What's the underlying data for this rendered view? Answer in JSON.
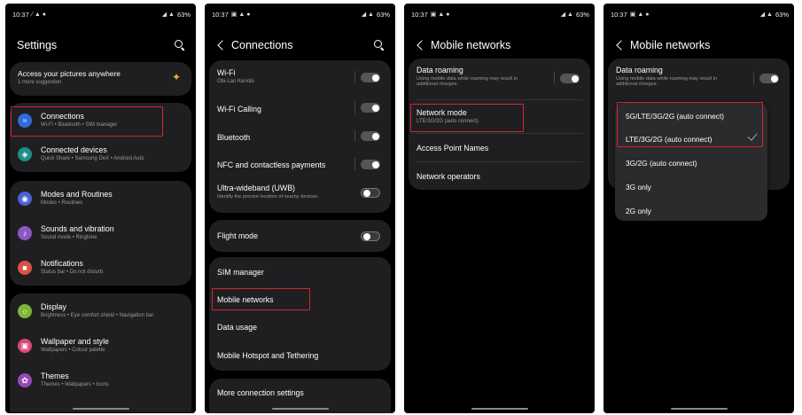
{
  "status": {
    "time": "10:37",
    "battery": "63%"
  },
  "settings": {
    "title": "Settings",
    "suggestion": {
      "title": "Access your pictures anywhere",
      "sub": "1 more suggestion"
    },
    "items": [
      {
        "label": "Connections",
        "sub": "Wi-Fi  •  Bluetooth  •  SIM manager",
        "color": "#2d6cdf",
        "icon": "wifi-icon"
      },
      {
        "label": "Connected devices",
        "sub": "Quick Share  •  Samsung DeX  •  Android Auto",
        "color": "#1f8f86",
        "icon": "devices-icon"
      },
      {
        "label": "Modes and Routines",
        "sub": "Modes  •  Routines",
        "color": "#4a63d6",
        "icon": "routine-icon"
      },
      {
        "label": "Sounds and vibration",
        "sub": "Sound mode  •  Ringtone",
        "color": "#8b58c8",
        "icon": "sound-icon"
      },
      {
        "label": "Notifications",
        "sub": "Status bar  •  Do not disturb",
        "color": "#d95245",
        "icon": "notification-icon"
      },
      {
        "label": "Display",
        "sub": "Brightness  •  Eye comfort shield  •  Navigation bar",
        "color": "#7fb436",
        "icon": "display-icon"
      },
      {
        "label": "Wallpaper and style",
        "sub": "Wallpapers  •  Colour palette",
        "color": "#d8497a",
        "icon": "wallpaper-icon"
      },
      {
        "label": "Themes",
        "sub": "Themes  •  Wallpapers  •  Icons",
        "color": "#9a47b8",
        "icon": "themes-icon"
      }
    ]
  },
  "connections": {
    "title": "Connections",
    "wifi": {
      "label": "Wi-Fi",
      "sub": "Obi-Lan Kenobi"
    },
    "wifi_calling": "Wi-Fi Calling",
    "bluetooth": "Bluetooth",
    "nfc": "NFC and contactless payments",
    "uwb": {
      "label": "Ultra-wideband (UWB)",
      "sub": "Identify the precise location of nearby devices."
    },
    "flight_mode": "Flight mode",
    "sim_manager": "SIM manager",
    "mobile_networks": "Mobile networks",
    "data_usage": "Data usage",
    "hotspot": "Mobile Hotspot and Tethering",
    "more": "More connection settings"
  },
  "mobile_networks": {
    "title": "Mobile networks",
    "data_roaming": {
      "label": "Data roaming",
      "sub1": "Using mobile data while roaming may result in",
      "sub2": "additional charges."
    },
    "network_mode": {
      "label": "Network mode",
      "sub": "LTE/3G/2G (auto connect)"
    },
    "apn": "Access Point Names",
    "operators": "Network operators"
  },
  "network_mode_popup": {
    "options": [
      "5G/LTE/3G/2G (auto connect)",
      "LTE/3G/2G (auto connect)",
      "3G/2G (auto connect)",
      "3G only",
      "2G only"
    ],
    "selected": "LTE/3G/2G (auto connect)"
  },
  "colors": {
    "highlight": "#d6262b",
    "card": "#1f1f21"
  }
}
